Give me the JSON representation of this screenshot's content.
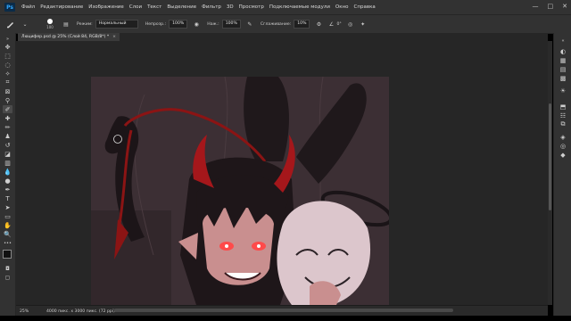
{
  "app": {
    "logo": "Ps"
  },
  "menubar": {
    "items": [
      "Файл",
      "Редактирование",
      "Изображение",
      "Слои",
      "Текст",
      "Выделение",
      "Фильтр",
      "3D",
      "Просмотр",
      "Подключаемые модули",
      "Окно",
      "Справка"
    ],
    "window_controls": [
      "—",
      "□",
      "✕"
    ]
  },
  "options": {
    "brush_size": "100",
    "mode_label": "Режим:",
    "mode_value": "Нормальный",
    "opacity_label": "Непрозр.:",
    "opacity_value": "100%",
    "pressure_label": "Наж.:",
    "pressure_value": "100%",
    "smoothing_label": "Сглаживание:",
    "smoothing_value": "10%",
    "angle_value": "0°"
  },
  "document": {
    "tab_title": "Люцифер.psd @ 25% (Слой 84, RGB/8*) *",
    "close": "×"
  },
  "status": {
    "zoom": "25%",
    "info": "4000 пикс. x 3000 пикс. (72 ppi)",
    "arrow": ">"
  },
  "icons": {
    "tools": [
      "move-icon",
      "marquee-icon",
      "lasso-icon",
      "quick-select-icon",
      "crop-icon",
      "frame-icon",
      "eyedropper-icon",
      "brush-icon",
      "healing-icon",
      "pencil-icon",
      "clone-stamp-icon",
      "history-brush-icon",
      "eraser-icon",
      "gradient-icon",
      "blur-icon",
      "dodge-icon",
      "pen-icon",
      "type-icon",
      "path-select-icon",
      "rectangle-icon",
      "hand-icon",
      "zoom-icon",
      "more-icon"
    ],
    "panels": [
      "collapse-icon",
      "color-icon",
      "swatches-icon",
      "gradients-icon",
      "patterns-icon",
      "adjustments-icon",
      "learn-icon",
      "libraries-icon",
      "properties-icon",
      "paths-icon",
      "channels-icon",
      "layers-icon"
    ]
  },
  "colors": {
    "foreground": "#111111",
    "background": "#d21b1b",
    "ps_blue": "#31a8ff"
  }
}
